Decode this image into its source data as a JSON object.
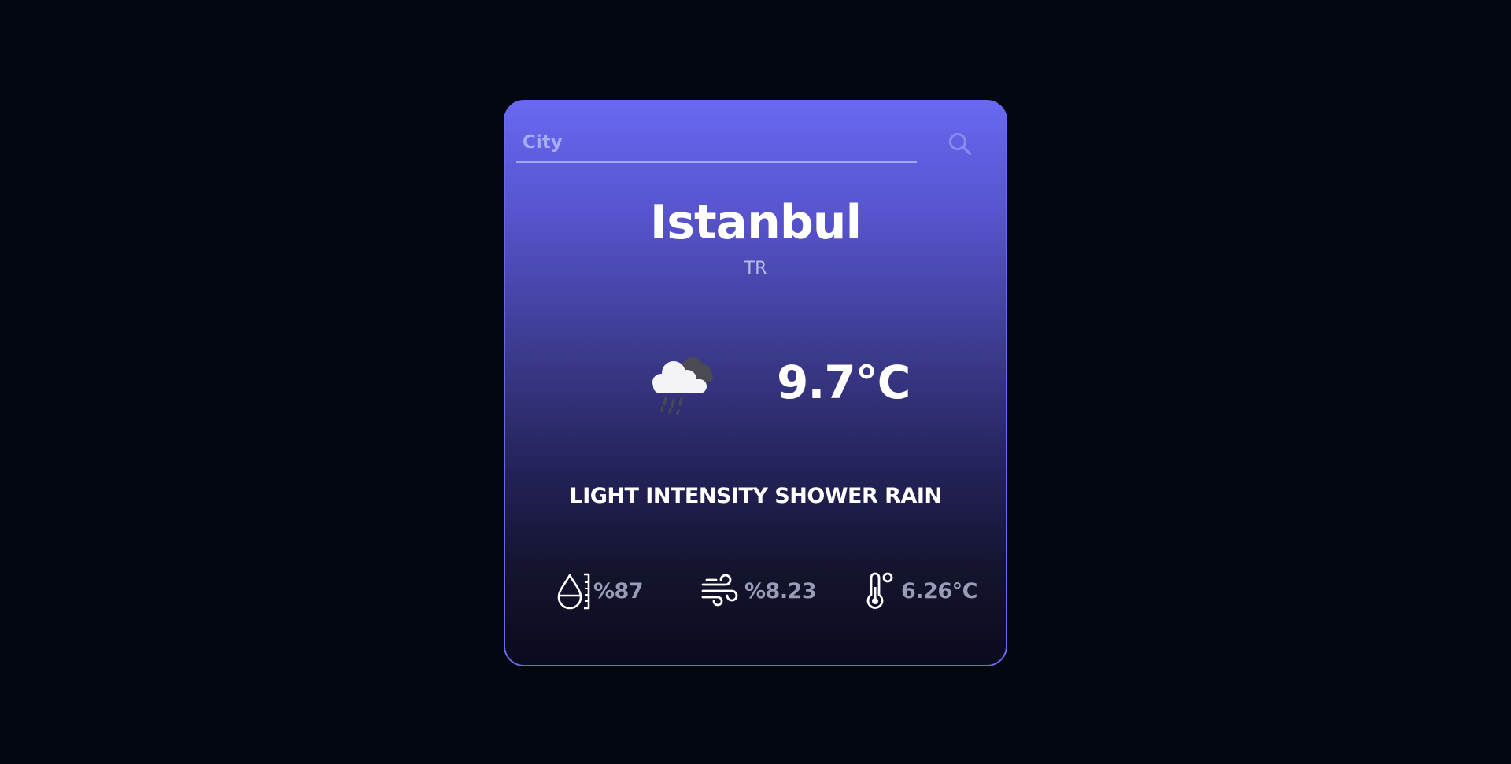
{
  "search": {
    "placeholder": "City",
    "value": "",
    "icon": "search-icon"
  },
  "location": {
    "city": "Istanbul",
    "country": "TR"
  },
  "current": {
    "icon": "rain-cloud-icon",
    "temperature": "9.7°C",
    "description": "LIGHT INTENSITY SHOWER RAIN"
  },
  "stats": {
    "humidity": {
      "icon": "humidity-icon",
      "value": "%87"
    },
    "wind": {
      "icon": "wind-icon",
      "value": "%8.23"
    },
    "feels_like": {
      "icon": "thermometer-icon",
      "value": "6.26°C"
    }
  },
  "colors": {
    "page_background": "#030712",
    "card_gradient_top": "#6868f2",
    "card_gradient_bottom": "#0a0b1c",
    "card_border": "#6b68f0",
    "stat_text": "#9a9bb6"
  }
}
